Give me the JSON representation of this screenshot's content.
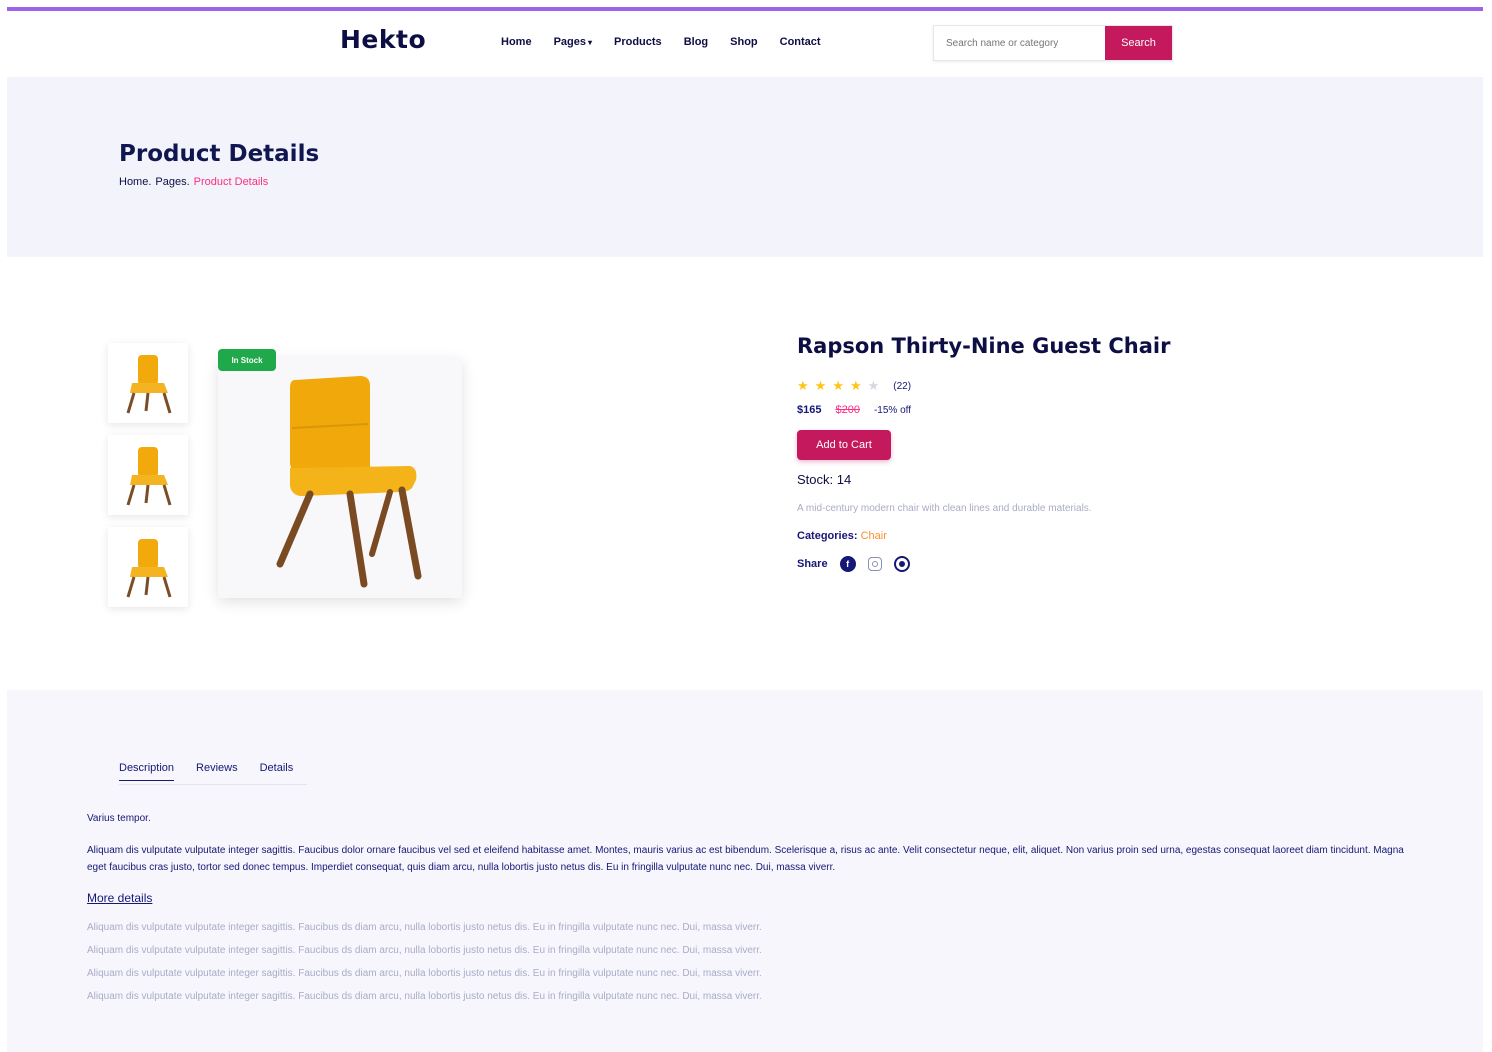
{
  "header": {
    "logo": "Hekto",
    "nav": [
      {
        "label": "Home",
        "has_dropdown": false
      },
      {
        "label": "Pages",
        "has_dropdown": true
      },
      {
        "label": "Products",
        "has_dropdown": false
      },
      {
        "label": "Blog",
        "has_dropdown": false
      },
      {
        "label": "Shop",
        "has_dropdown": false
      },
      {
        "label": "Contact",
        "has_dropdown": false
      }
    ],
    "search": {
      "placeholder": "Search name or category",
      "button_label": "Search"
    }
  },
  "banner": {
    "title": "Product Details",
    "breadcrumb": [
      "Home.",
      "Pages.",
      "Product Details"
    ]
  },
  "product": {
    "badge": "In Stock",
    "title": "Rapson Thirty-Nine Guest Chair",
    "rating": 4,
    "rating_max": 5,
    "review_count": "(22)",
    "price": "$165",
    "old_price": "$200",
    "discount": "-15% off",
    "add_to_cart_label": "Add to Cart",
    "stock": "Stock: 14",
    "description": "A mid-century modern chair with clean lines and durable materials.",
    "categories_label": "Categories:",
    "category": "Chair",
    "share_label": "Share"
  },
  "tabs": [
    {
      "label": "Description",
      "active": true
    },
    {
      "label": "Reviews",
      "active": false
    },
    {
      "label": "Details",
      "active": false
    }
  ],
  "description_section": {
    "heading": "Varius tempor.",
    "paragraph": "Aliquam dis vulputate vulputate integer sagittis. Faucibus dolor ornare faucibus vel sed et eleifend habitasse amet. Montes, mauris varius ac est bibendum. Scelerisque a, risus ac ante. Velit consectetur neque, elit, aliquet. Non varius proin sed urna, egestas consequat laoreet diam tincidunt. Magna eget faucibus cras justo, tortor sed donec tempus. Imperdiet consequat, quis diam arcu, nulla lobortis justo netus dis. Eu in fringilla vulputate nunc nec. Dui, massa viverr.",
    "more_heading": "More details",
    "more_items": [
      "Aliquam dis vulputate vulputate integer sagittis. Faucibus ds diam arcu, nulla lobortis justo netus dis. Eu in fringilla vulputate nunc nec. Dui, massa viverr.",
      "Aliquam dis vulputate vulputate integer sagittis. Faucibus ds diam arcu, nulla lobortis justo netus dis. Eu in fringilla vulputate nunc nec. Dui, massa viverr.",
      "Aliquam dis vulputate vulputate integer sagittis. Faucibus ds diam arcu, nulla lobortis justo netus dis. Eu in fringilla vulputate nunc nec. Dui, massa viverr.",
      "Aliquam dis vulputate vulputate integer sagittis. Faucibus ds diam arcu, nulla lobortis justo netus dis. Eu in fringilla vulputate nunc nec. Dui, massa viverr."
    ]
  },
  "colors": {
    "accent_bar": "#9f63e8",
    "primary_pink": "#c4195c",
    "navy": "#101750",
    "breadcrumb_active": "#fb2e86",
    "category": "#fb8f2e",
    "badge_green": "#1fa94a",
    "star": "#ffc416"
  },
  "icons": {
    "share": [
      "facebook-icon",
      "instagram-icon",
      "github-icon"
    ]
  }
}
